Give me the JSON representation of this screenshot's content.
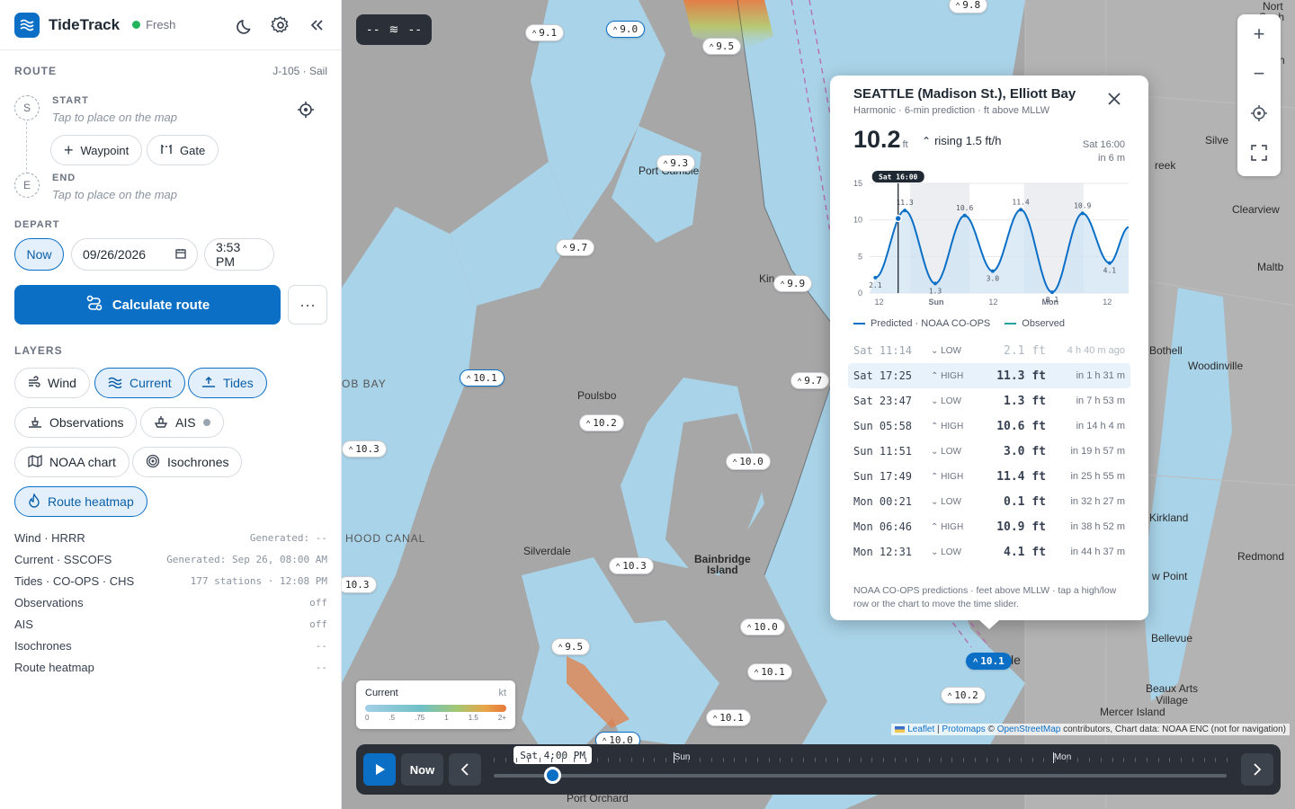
{
  "app": {
    "title": "TideTrack",
    "status": "Fresh"
  },
  "route": {
    "heading": "ROUTE",
    "vessel": "J-105 · Sail",
    "start_label": "START",
    "start_hint": "Tap to place on the map",
    "start_marker": "S",
    "end_label": "END",
    "end_hint": "Tap to place on the map",
    "end_marker": "E",
    "waypoint_label": "Waypoint",
    "gate_label": "Gate"
  },
  "depart": {
    "heading": "DEPART",
    "now_label": "Now",
    "date_value": "09/26/2026",
    "time_value": "3:53 PM"
  },
  "calc_label": "Calculate route",
  "more_label": "···",
  "layers": {
    "heading": "LAYERS",
    "wind": "Wind",
    "current": "Current",
    "tides": "Tides",
    "observations": "Observations",
    "ais": "AIS",
    "noaa_chart": "NOAA chart",
    "isochrones": "Isochrones",
    "route_heatmap": "Route heatmap"
  },
  "status": [
    {
      "name": "Wind · HRRR",
      "value": "Generated: --"
    },
    {
      "name": "Current · SSCOFS",
      "value": "Generated: Sep 26, 08:00 AM"
    },
    {
      "name": "Tides · CO-OPS · CHS",
      "value": "177 stations · 12:08 PM"
    },
    {
      "name": "Observations",
      "value": "off"
    },
    {
      "name": "AIS",
      "value": "off"
    },
    {
      "name": "Isochrones",
      "value": "--"
    },
    {
      "name": "Route heatmap",
      "value": "--"
    }
  ],
  "map": {
    "wind_chip": {
      "left": "--",
      "right": "--"
    },
    "labels": {
      "port_gamble": "Port Gamble",
      "kingston": "Kin",
      "poulsbo": "Poulsbo",
      "silverdale": "Silverdale",
      "bainbridge": "Bainbridge\nIsland",
      "hood_canal": "HOOD CANAL",
      "dob_bay": "OB BAY",
      "seattle": "le",
      "port_orchard": "Port Orchard",
      "mercer": "Mercer Island",
      "beaux_arts": "Beaux Arts\nVillage",
      "bellevue": "Bellevue",
      "redmond": "Redmond",
      "kirkland": "Kirkland",
      "woodinville": "Woodinville",
      "bothell": "Bothell",
      "clearview": "Clearview",
      "maltby": "Maltb",
      "silver": "Silve",
      "creek": "reek",
      "north": "Nort",
      "snoh": "Snoh",
      "sn": "Sn",
      "w_point": "w Point"
    },
    "tide_tags": [
      {
        "v": "9.1"
      },
      {
        "v": "9.0"
      },
      {
        "v": "9.8"
      },
      {
        "v": "9.5"
      },
      {
        "v": "9.3"
      },
      {
        "v": "9.7"
      },
      {
        "v": "9.9"
      },
      {
        "v": "10.1"
      },
      {
        "v": "9.7"
      },
      {
        "v": "10.2"
      },
      {
        "v": "10.3"
      },
      {
        "v": "10.0"
      },
      {
        "v": "10.3"
      },
      {
        "v": "10.3"
      },
      {
        "v": "10.0"
      },
      {
        "v": "9.5"
      },
      {
        "v": "10.1"
      },
      {
        "v": "10.1"
      },
      {
        "v": "10.1"
      },
      {
        "v": "10.2"
      },
      {
        "v": "10.0"
      }
    ],
    "attribution": {
      "leaflet": "Leaflet",
      "sep": " | ",
      "protomaps": "Protomaps",
      "osm_prefix": " © ",
      "osm": "OpenStreetMap",
      "rest": " contributors, Chart data: NOAA ENC (not for navigation)"
    }
  },
  "tide_card": {
    "station": "SEATTLE (Madison St.), Elliott Bay",
    "subtitle": "Harmonic · 6-min prediction · ft above MLLW",
    "height": "10.2",
    "unit": "ft",
    "trend": "rising 1.5 ft/h",
    "time": "Sat 16:00",
    "in": "in 6 m",
    "legend_predicted": "Predicted · NOAA CO-OPS",
    "legend_observed": "Observed",
    "extremes": [
      {
        "t": "Sat 11:14",
        "kind": "LOW",
        "h": "2.1 ft",
        "rel": "4 h 40 m ago",
        "past": true
      },
      {
        "t": "Sat 17:25",
        "kind": "HIGH",
        "h": "11.3 ft",
        "rel": "in 1 h 31 m",
        "highlight": true
      },
      {
        "t": "Sat 23:47",
        "kind": "LOW",
        "h": "1.3 ft",
        "rel": "in 7 h 53 m"
      },
      {
        "t": "Sun 05:58",
        "kind": "HIGH",
        "h": "10.6 ft",
        "rel": "in 14 h 4 m"
      },
      {
        "t": "Sun 11:51",
        "kind": "LOW",
        "h": "3.0 ft",
        "rel": "in 19 h 57 m"
      },
      {
        "t": "Sun 17:49",
        "kind": "HIGH",
        "h": "11.4 ft",
        "rel": "in 25 h 55 m"
      },
      {
        "t": "Mon 00:21",
        "kind": "LOW",
        "h": "0.1 ft",
        "rel": "in 32 h 27 m"
      },
      {
        "t": "Mon 06:46",
        "kind": "HIGH",
        "h": "10.9 ft",
        "rel": "in 38 h 52 m"
      },
      {
        "t": "Mon 12:31",
        "kind": "LOW",
        "h": "4.1 ft",
        "rel": "in 44 h 37 m"
      }
    ],
    "footnote": "NOAA CO-OPS predictions · feet above MLLW · tap a high/low row or the chart to move the time slider."
  },
  "chart_data": {
    "type": "line",
    "title": "",
    "cursor_label": "Sat 16:00",
    "ylim": [
      0,
      15
    ],
    "yticks": [
      0,
      5,
      10,
      15
    ],
    "xticks": [
      "12",
      "Sun",
      "12",
      "Mon",
      "12"
    ],
    "series": [
      {
        "name": "Predicted · NOAA CO-OPS",
        "points": [
          [
            -4.8,
            2.1
          ],
          [
            1.4,
            11.3
          ],
          [
            7.8,
            1.3
          ],
          [
            14.0,
            10.6
          ],
          [
            19.9,
            3.0
          ],
          [
            25.8,
            11.4
          ],
          [
            32.4,
            0.1
          ],
          [
            38.8,
            10.9
          ],
          [
            44.5,
            4.1
          ],
          [
            48.5,
            9.0
          ]
        ]
      }
    ],
    "labels": [
      {
        "x": -4.8,
        "y": 2.1,
        "text": "2.1"
      },
      {
        "x": 1.4,
        "y": 11.3,
        "text": "11.3"
      },
      {
        "x": 7.8,
        "y": 1.3,
        "text": "1.3"
      },
      {
        "x": 14.0,
        "y": 10.6,
        "text": "10.6"
      },
      {
        "x": 19.9,
        "y": 3.0,
        "text": "3.0"
      },
      {
        "x": 25.8,
        "y": 11.4,
        "text": "11.4"
      },
      {
        "x": 32.4,
        "y": 0.1,
        "text": "0.1"
      },
      {
        "x": 38.8,
        "y": 10.9,
        "text": "10.9"
      },
      {
        "x": 44.5,
        "y": 4.1,
        "text": "4.1"
      }
    ],
    "now_x": 0,
    "night_bands": [
      [
        2.5,
        15.0
      ],
      [
        26.5,
        39.0
      ]
    ]
  },
  "current_legend": {
    "title": "Current",
    "unit": "kt",
    "ticks": [
      "0",
      ".5",
      ".75",
      "1",
      "1.5",
      "2+"
    ]
  },
  "timeline": {
    "now_label": "Now",
    "current_time": "Sat 4:00 PM",
    "progress": 0.08,
    "days": [
      {
        "label": "Sun",
        "pos": 0.245
      },
      {
        "label": "Mon",
        "pos": 0.763
      }
    ]
  },
  "colors": {
    "accent": "#0b6fc6",
    "water": "#a9d3e8",
    "land": "#a8a8a8",
    "fresh": "#22b35b"
  }
}
